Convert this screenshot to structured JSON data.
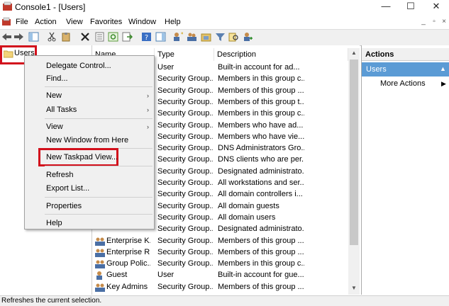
{
  "window": {
    "title": "Console1 - [Users]",
    "minimize": "—",
    "maximize": "☐",
    "close": "✕"
  },
  "menubar": {
    "items": [
      "File",
      "Action",
      "View",
      "Favorites",
      "Window",
      "Help"
    ],
    "mdi_min": "_",
    "mdi_restore": "▫",
    "mdi_close": "×"
  },
  "tree": {
    "selected": "Users"
  },
  "list": {
    "headers": {
      "name": "Name",
      "type": "Type",
      "description": "Description"
    },
    "rows": [
      {
        "name": "",
        "type": "User",
        "description": "Built-in account for ad..."
      },
      {
        "name": "",
        "type": "Security Group...",
        "description": "Members in this group c..."
      },
      {
        "name": "",
        "type": "Security Group...",
        "description": "Members of this group ..."
      },
      {
        "name": "",
        "type": "Security Group...",
        "description": "Members of this group t..."
      },
      {
        "name": "",
        "type": "Security Group...",
        "description": "Members in this group c..."
      },
      {
        "name": "",
        "type": "Security Group...",
        "description": "Members who have ad..."
      },
      {
        "name": "",
        "type": "Security Group...",
        "description": "Members who have vie..."
      },
      {
        "name": "",
        "type": "Security Group...",
        "description": "DNS Administrators Gro..."
      },
      {
        "name": "",
        "type": "Security Group...",
        "description": "DNS clients who are per..."
      },
      {
        "name": "",
        "type": "Security Group...",
        "description": "Designated administrato..."
      },
      {
        "name": "",
        "type": "Security Group...",
        "description": "All workstations and ser..."
      },
      {
        "name": "",
        "type": "Security Group...",
        "description": "All domain controllers i..."
      },
      {
        "name": "",
        "type": "Security Group...",
        "description": "All domain guests"
      },
      {
        "name": "",
        "type": "Security Group...",
        "description": "All domain users"
      },
      {
        "name": "",
        "type": "Security Group...",
        "description": "Designated administrato..."
      },
      {
        "name": "Enterprise K...",
        "type": "Security Group...",
        "description": "Members of this group ..."
      },
      {
        "name": "Enterprise R...",
        "type": "Security Group...",
        "description": "Members of this group ..."
      },
      {
        "name": "Group Polic...",
        "type": "Security Group...",
        "description": "Members in this group c..."
      },
      {
        "name": "Guest",
        "type": "User",
        "description": "Built-in account for gue..."
      },
      {
        "name": "Key Admins",
        "type": "Security Group...",
        "description": "Members of this group ..."
      }
    ]
  },
  "context_menu": {
    "items": [
      {
        "label": "Delegate Control...",
        "submenu": false
      },
      {
        "label": "Find...",
        "submenu": false
      },
      {
        "label": "New",
        "submenu": true
      },
      {
        "label": "All Tasks",
        "submenu": true
      },
      {
        "label": "View",
        "submenu": true
      },
      {
        "label": "New Window from Here",
        "submenu": false
      },
      {
        "label": "New Taskpad View...",
        "submenu": false
      },
      {
        "label": "Refresh",
        "submenu": false
      },
      {
        "label": "Export List...",
        "submenu": false
      },
      {
        "label": "Properties",
        "submenu": false
      },
      {
        "label": "Help",
        "submenu": false
      }
    ],
    "arrow": "›"
  },
  "actions": {
    "header": "Actions",
    "section": "Users",
    "section_arrow": "▲",
    "more": "More Actions",
    "more_arrow": "▶"
  },
  "status": {
    "text": "Refreshes the current selection."
  },
  "colors": {
    "highlight_box": "#d2101c",
    "selection_blue": "#5b9bd5"
  }
}
